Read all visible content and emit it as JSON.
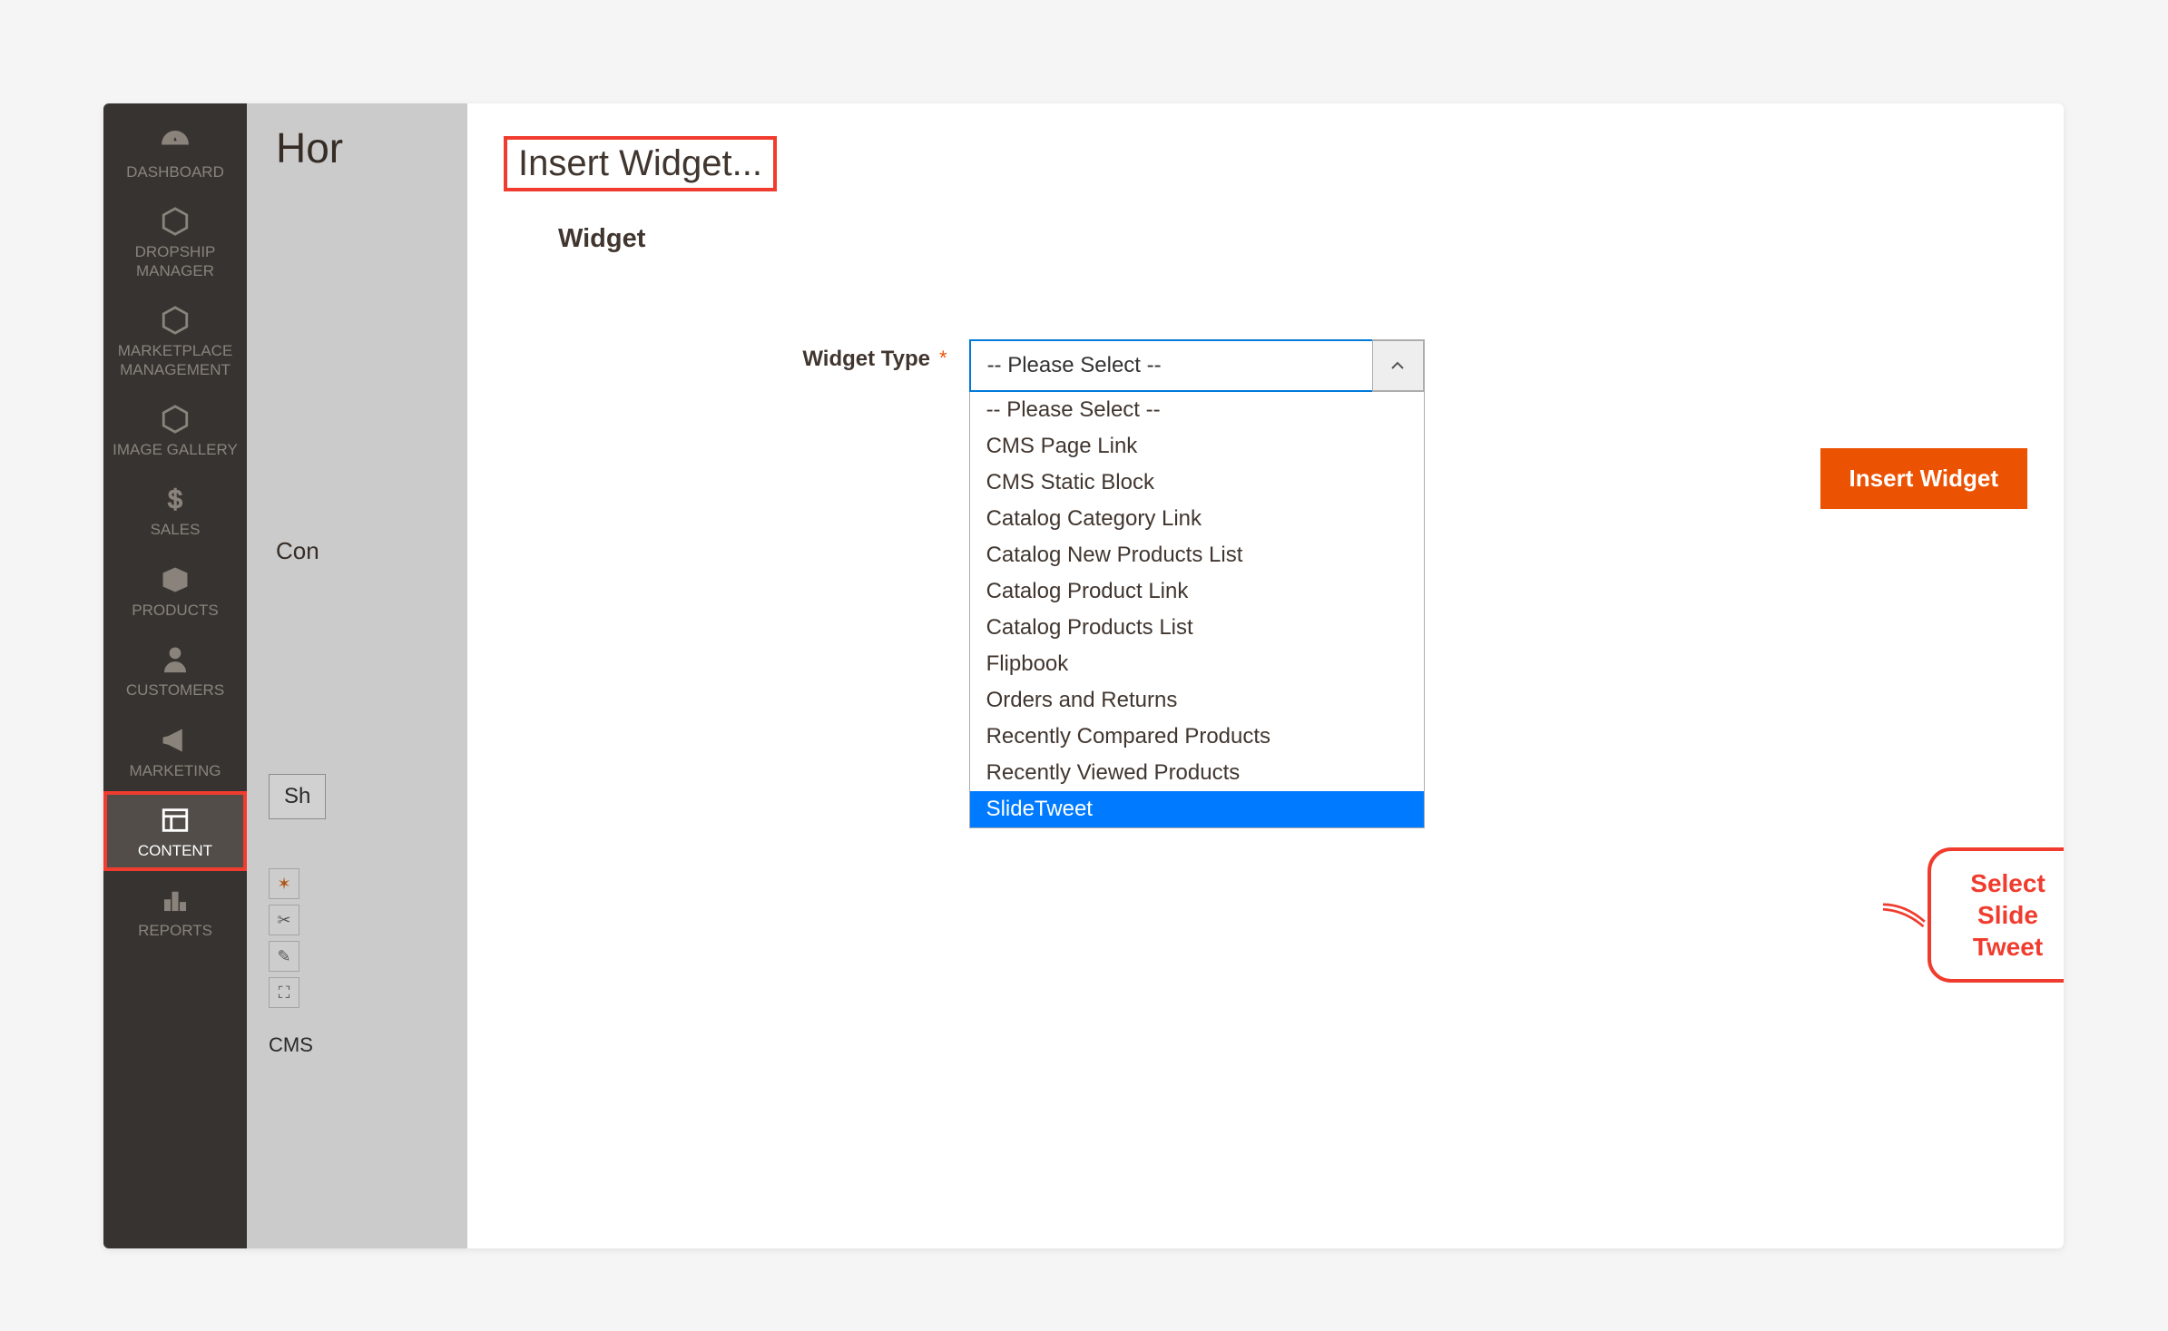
{
  "sidebar": {
    "items": [
      {
        "label": "DASHBOARD"
      },
      {
        "label": "DROPSHIP MANAGER"
      },
      {
        "label": "MARKETPLACE MANAGEMENT"
      },
      {
        "label": "IMAGE GALLERY"
      },
      {
        "label": "SALES"
      },
      {
        "label": "PRODUCTS"
      },
      {
        "label": "CUSTOMERS"
      },
      {
        "label": "MARKETING"
      },
      {
        "label": "CONTENT"
      },
      {
        "label": "REPORTS"
      }
    ]
  },
  "background": {
    "page_title_partial": "Hor",
    "content_label_partial": "Con",
    "sh_input_partial": "Sh",
    "cms_partial": "CMS"
  },
  "modal": {
    "title": "Insert Widget...",
    "section": "Widget",
    "form_label": "Widget Type",
    "select_value": "-- Please Select --",
    "insert_button": "Insert Widget",
    "dropdown_options": [
      "-- Please Select --",
      "CMS Page Link",
      "CMS Static Block",
      "Catalog Category Link",
      "Catalog New Products List",
      "Catalog Product Link",
      "Catalog Products List",
      "Flipbook",
      "Orders and Returns",
      "Recently Compared Products",
      "Recently Viewed Products",
      "SlideTweet"
    ],
    "selected_option_index": 11
  },
  "callout": {
    "line1": "Select Slide",
    "line2": "Tweet"
  }
}
